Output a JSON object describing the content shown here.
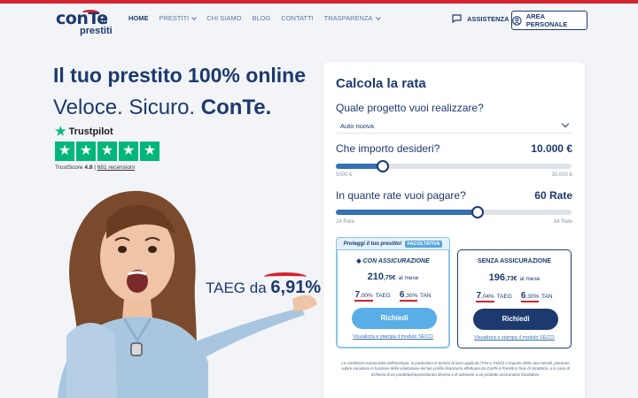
{
  "brand": {
    "logo_main": "conTe",
    "logo_tld": ".it",
    "logo_sub": "prestiti",
    "red": "#d3232f",
    "navy": "#1d3a6e"
  },
  "nav": {
    "items": [
      {
        "label": "HOME",
        "active": true,
        "dropdown": false
      },
      {
        "label": "PRESTITI",
        "active": false,
        "dropdown": true
      },
      {
        "label": "CHI SIAMO",
        "active": false,
        "dropdown": false
      },
      {
        "label": "BLOG",
        "active": false,
        "dropdown": false
      },
      {
        "label": "CONTATTI",
        "active": false,
        "dropdown": false
      },
      {
        "label": "TRASPARENZA",
        "active": false,
        "dropdown": true
      }
    ],
    "assistenza": "ASSISTENZA",
    "area_personale": "AREA PERSONALE"
  },
  "hero": {
    "title": "Il tuo prestito 100% online",
    "sub_plain": "Veloce. Sicuro. ",
    "sub_bold": "ConTe.",
    "trustpilot": {
      "brand": "Trustpilot",
      "score_label": "TrustScore",
      "score": "4.8",
      "separator": "|",
      "reviews": "681 recensioni",
      "stars": 5
    },
    "taeg_label": "TAEG da ",
    "taeg_value": "6,91%"
  },
  "calculator": {
    "title": "Calcola la rata",
    "project_question": "Quale progetto vuoi realizzare?",
    "project_value": "Auto nuova",
    "amount_question": "Che importo desideri?",
    "amount_value": "10.000 €",
    "amount_min": "5000 €",
    "amount_max": "30.000 €",
    "amount_fraction": 0.2,
    "rate_question": "In quante rate vuoi pagare?",
    "rate_value": "60 Rate",
    "rate_min": "24 Rate",
    "rate_max": "84 Rate",
    "rate_fraction": 0.6,
    "protect_tag": "Proteggi il tuo prestito!",
    "protect_badge": "FACOLTATIVA",
    "plans": [
      {
        "title": "CON ASSICURAZIONE",
        "amount_int": "210",
        "amount_dec": ",75€",
        "per": "al mese",
        "taeg_int": "7",
        "taeg_dec": ",00%",
        "taeg_label": "TAEG",
        "tan_int": "6",
        "tan_dec": ",30%",
        "tan_label": "TAN",
        "button": "Richiedi",
        "link": "Visualizza e stampa il modulo SECCI"
      },
      {
        "title": "SENZA ASSICURAZIONE",
        "amount_int": "196",
        "amount_dec": ",73€",
        "per": "al mese",
        "taeg_int": "7",
        "taeg_dec": ",04%",
        "taeg_label": "TAEG",
        "tan_int": "6",
        "tan_dec": ",30%",
        "tan_label": "TAN",
        "button": "Richiedi",
        "link": "Visualizza e stampa il modulo SECCI"
      }
    ],
    "fine_print": "Le condizioni economiche dell'esempio, in particolare in termini di tassi applicati (TAN e TAEG) e importo della rata mensili, potranno subire variazioni in funzione della valutazione del tuo profilo finanziario effettuata da ConTe.it Prestiti in fase di istruttoria, o in caso di richiesta di un prodotto/importo/durata diverso e di adesione a un prodotto assicurativo facoltativo."
  }
}
